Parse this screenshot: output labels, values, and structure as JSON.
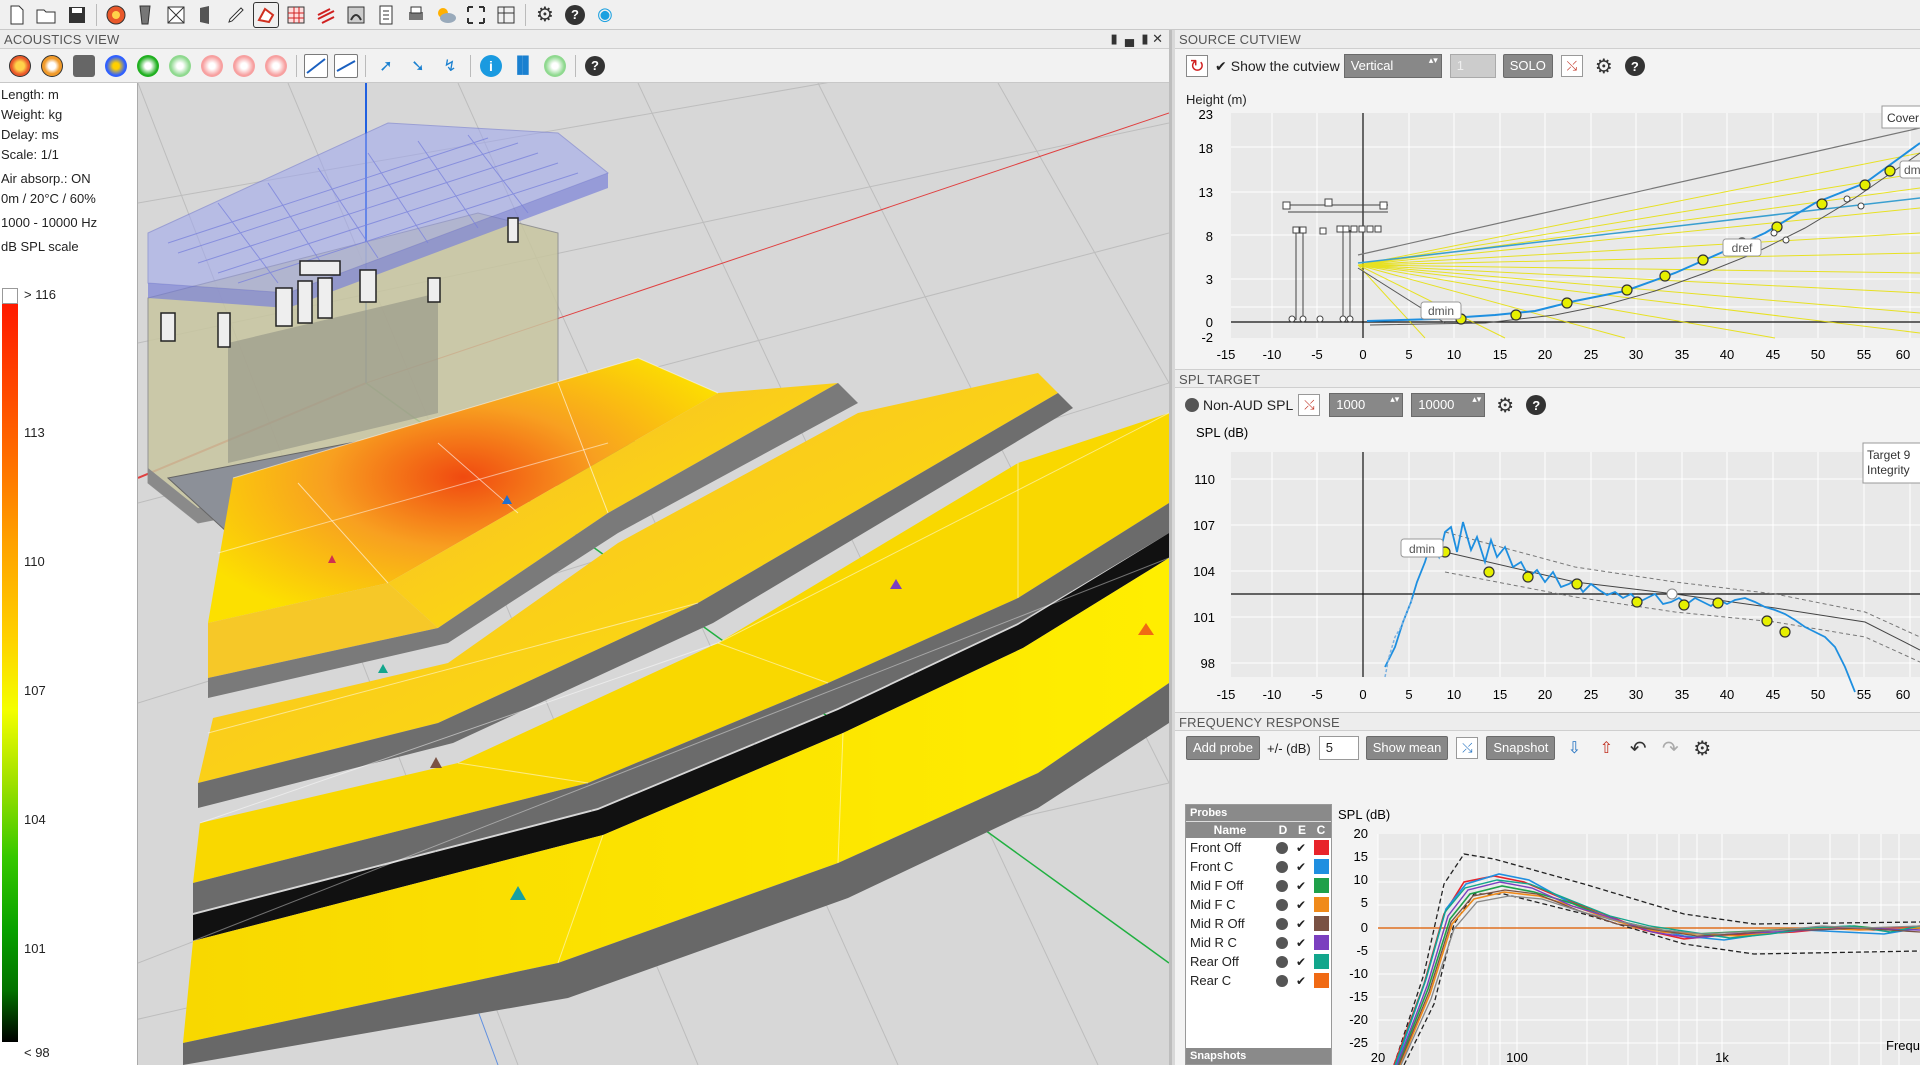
{
  "toolbar": {
    "icons": [
      "new-file-icon",
      "open-folder-icon",
      "save-icon",
      "sound-source-icon",
      "speaker-array-icon",
      "stage-icon",
      "cabinet-icon",
      "pen-icon",
      "polygon-icon",
      "grid-map-icon",
      "heatmap-icon",
      "surface-icon",
      "document-icon",
      "print-icon",
      "weather-icon",
      "fit-view-icon",
      "layout-icon",
      "settings-icon",
      "help-icon",
      "globe-icon"
    ]
  },
  "acoustics_view": {
    "title": "ACOUSTICS VIEW",
    "legend": {
      "length": "Length: m",
      "weight": "Weight: kg",
      "delay": "Delay: ms",
      "scale": "Scale: 1/1",
      "air_absorption": "Air absorp.: ON",
      "conditions": "0m / 20°C / 60%",
      "band": "1000 - 10000 Hz",
      "scale_title": "dB SPL scale",
      "top_label": "> 116",
      "bottom_label": "< 98",
      "ticks": [
        "113",
        "110",
        "107",
        "104",
        "101"
      ]
    }
  },
  "source_cutview": {
    "title": "SOURCE CUTVIEW",
    "show_label": "Show the cutview",
    "orientation": "Vertical",
    "index_value": "1",
    "solo_label": "SOLO",
    "y_axis_label": "Height (m)",
    "y_ticks": [
      "23",
      "18",
      "13",
      "8",
      "3",
      "0",
      "-2"
    ],
    "x_ticks": [
      "-15",
      "-10",
      "-5",
      "0",
      "5",
      "10",
      "15",
      "20",
      "25",
      "30",
      "35",
      "40",
      "45",
      "50",
      "55",
      "60"
    ],
    "tags": {
      "dmin": "dmin",
      "dref": "dref",
      "dmax": "dm",
      "coverage": "Cover"
    }
  },
  "spl_target": {
    "title": "SPL TARGET",
    "mode_label": "Non-AUD SPL",
    "freq_low": "1000",
    "freq_high": "10000",
    "y_axis_label": "SPL (dB)",
    "y_ticks": [
      "110",
      "107",
      "104",
      "101",
      "98"
    ],
    "x_ticks": [
      "-15",
      "-10",
      "-5",
      "0",
      "5",
      "10",
      "15",
      "20",
      "25",
      "30",
      "35",
      "40",
      "45",
      "50",
      "55",
      "60"
    ],
    "dmin_tag": "dmin",
    "target_tag_line1": "Target 9",
    "target_tag_line2": "Integrity"
  },
  "frequency_response": {
    "title": "FREQUENCY RESPONSE",
    "add_probe": "Add probe",
    "tolerance_label": "+/- (dB)",
    "tolerance_value": "5",
    "show_mean": "Show mean",
    "snapshot": "Snapshot",
    "probes_header": "Probes",
    "snapshots_header": "Snapshots",
    "columns": {
      "name": "Name",
      "d": "D",
      "e": "E",
      "c": "C"
    },
    "probes": [
      {
        "name": "Front Off",
        "color": "#e8232a"
      },
      {
        "name": "Front C",
        "color": "#1f8fe0"
      },
      {
        "name": "Mid F Off",
        "color": "#1fa04a"
      },
      {
        "name": "Mid F C",
        "color": "#f08a1a"
      },
      {
        "name": "Mid R Off",
        "color": "#7a5244"
      },
      {
        "name": "Mid R C",
        "color": "#7b3fbf"
      },
      {
        "name": "Rear Off",
        "color": "#12a68c"
      },
      {
        "name": "Rear C",
        "color": "#f06a14"
      }
    ],
    "y_axis_label": "SPL (dB)",
    "y_ticks": [
      "20",
      "15",
      "10",
      "5",
      "0",
      "-5",
      "-10",
      "-15",
      "-20",
      "-25"
    ],
    "x_ticks": [
      "20",
      "100",
      "1k"
    ],
    "x_axis_label": "Frequ"
  }
}
